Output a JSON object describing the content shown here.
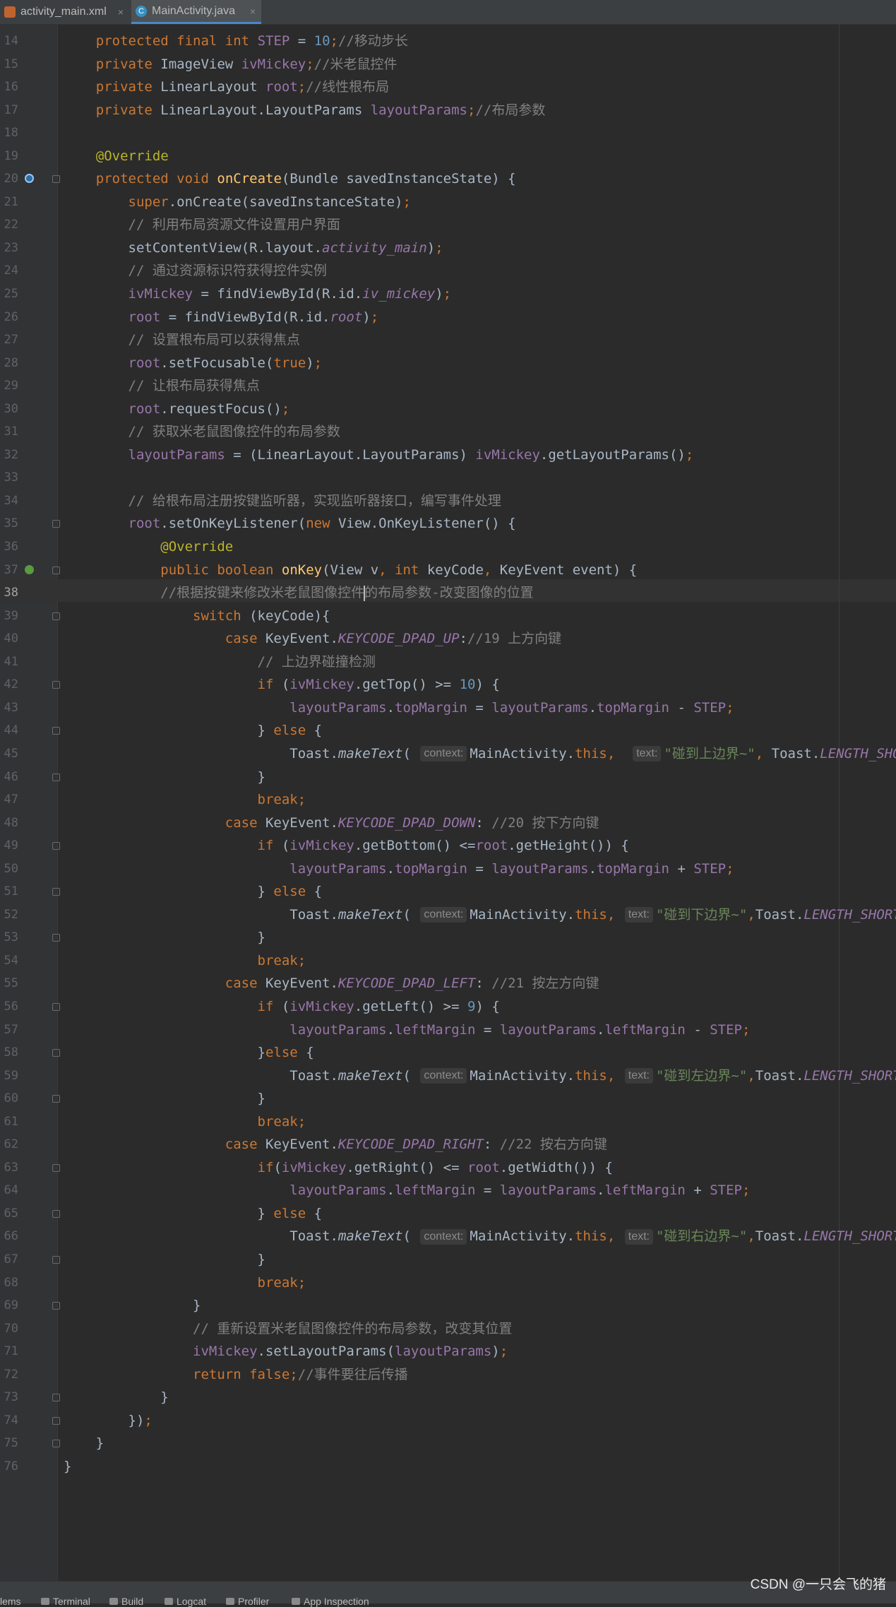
{
  "tabs": [
    {
      "label": "activity_main.xml",
      "close": "×",
      "icon": "xml-file-icon"
    },
    {
      "label": "MainActivity.java",
      "close": "×",
      "icon": "java-class-icon",
      "active": true
    }
  ],
  "editor": {
    "current_line": 38,
    "lines": [
      {
        "n": "14",
        "html": "    <span class=\"k\">protected final int</span> <span class=\"f\">STEP</span> = <span class=\"n\">10</span><span class=\"k\">;</span><span class=\"c\">//移动步长</span>"
      },
      {
        "n": "15",
        "html": "    <span class=\"k\">private</span> ImageView <span class=\"f\">ivMickey</span><span class=\"k\">;</span><span class=\"c\">//米老鼠控件</span>"
      },
      {
        "n": "16",
        "html": "    <span class=\"k\">private</span> LinearLayout <span class=\"f\">root</span><span class=\"k\">;</span><span class=\"c\">//线性根布局</span>"
      },
      {
        "n": "17",
        "html": "    <span class=\"k\">private</span> LinearLayout.LayoutParams <span class=\"f\">layoutParams</span><span class=\"k\">;</span><span class=\"c\">//布局参数</span>"
      },
      {
        "n": "18",
        "html": ""
      },
      {
        "n": "19",
        "html": "    <span class=\"a\">@Override</span>"
      },
      {
        "n": "20",
        "html": "    <span class=\"k\">protected void</span> <span class=\"m\">onCreate</span>(Bundle savedInstanceState) {",
        "marker": "override",
        "fold": true
      },
      {
        "n": "21",
        "html": "        <span class=\"k\">super</span>.onCreate(savedInstanceState)<span class=\"k\">;</span>"
      },
      {
        "n": "22",
        "html": "        <span class=\"c\">// 利用布局资源文件设置用户界面</span>"
      },
      {
        "n": "23",
        "html": "        setContentView(R.layout.<span class=\"fi2\">activity_main</span>)<span class=\"k\">;</span>"
      },
      {
        "n": "24",
        "html": "        <span class=\"c\">// 通过资源标识符获得控件实例</span>"
      },
      {
        "n": "25",
        "html": "        <span class=\"f\">ivMickey</span> = findViewById(R.id.<span class=\"fi2\">iv_mickey</span>)<span class=\"k\">;</span>"
      },
      {
        "n": "26",
        "html": "        <span class=\"f\">root</span> = findViewById(R.id.<span class=\"fi2\">root</span>)<span class=\"k\">;</span>"
      },
      {
        "n": "27",
        "html": "        <span class=\"c\">// 设置根布局可以获得焦点</span>"
      },
      {
        "n": "28",
        "html": "        <span class=\"f\">root</span>.setFocusable(<span class=\"k\">true</span>)<span class=\"k\">;</span>"
      },
      {
        "n": "29",
        "html": "        <span class=\"c\">// 让根布局获得焦点</span>"
      },
      {
        "n": "30",
        "html": "        <span class=\"f\">root</span>.requestFocus()<span class=\"k\">;</span>"
      },
      {
        "n": "31",
        "html": "        <span class=\"c\">// 获取米老鼠图像控件的布局参数</span>"
      },
      {
        "n": "32",
        "html": "        <span class=\"f\">layoutParams</span> = (LinearLayout.LayoutParams) <span class=\"f\">ivMickey</span>.getLayoutParams()<span class=\"k\">;</span>"
      },
      {
        "n": "33",
        "html": ""
      },
      {
        "n": "34",
        "html": "        <span class=\"c\">// 给根布局注册按键监听器，实现监听器接口，编写事件处理</span>"
      },
      {
        "n": "35",
        "html": "        <span class=\"f\">root</span>.setOnKeyListener(<span class=\"k\">new</span> View.OnKeyListener() {",
        "fold": true
      },
      {
        "n": "36",
        "html": "            <span class=\"a\">@Override</span>"
      },
      {
        "n": "37",
        "html": "            <span class=\"k\">public boolean</span> <span class=\"m\">onKey</span>(View v<span class=\"k\">, int</span> keyCode<span class=\"k\">,</span> KeyEvent event) {",
        "marker": "implement",
        "fold": true
      },
      {
        "n": "38",
        "html": "            <span class=\"c\">//根据按键来修改米老鼠图像控件</span><span class=\"caret\"></span><span class=\"c\">的布局参数-改变图像的位置</span>"
      },
      {
        "n": "39",
        "html": "                <span class=\"k\">switch</span> (keyCode){",
        "fold": true
      },
      {
        "n": "40",
        "html": "                    <span class=\"k\">case</span> KeyEvent.<span class=\"fi2\">KEYCODE_DPAD_UP</span>:<span class=\"c\">//19 上方向键</span>"
      },
      {
        "n": "41",
        "html": "                        <span class=\"c\">// 上边界碰撞检测</span>"
      },
      {
        "n": "42",
        "html": "                        <span class=\"k\">if</span> (<span class=\"f\">ivMickey</span>.getTop() &gt;= <span class=\"n\">10</span>) {",
        "fold": true
      },
      {
        "n": "43",
        "html": "                            <span class=\"f\">layoutParams</span>.<span class=\"f\">topMargin</span> = <span class=\"f\">layoutParams</span>.<span class=\"f\">topMargin</span> - <span class=\"f\">STEP</span><span class=\"k\">;</span>"
      },
      {
        "n": "44",
        "html": "                        } <span class=\"k\">else</span> {",
        "fold": true
      },
      {
        "n": "45",
        "html": "                            Toast.<span class=\"i\">makeText</span>( <span class=\"hint\">context:</span>MainActivity.<span class=\"k\">this,</span>  <span class=\"hint\">text:</span><span class=\"s\">\"碰到上边界~\"</span><span class=\"k\">,</span> Toast.<span class=\"fi2\">LENGTH_SHORT</span>)."
      },
      {
        "n": "46",
        "html": "                        }",
        "fold": true
      },
      {
        "n": "47",
        "html": "                        <span class=\"k\">break;</span>"
      },
      {
        "n": "48",
        "html": "                    <span class=\"k\">case</span> KeyEvent.<span class=\"fi2\">KEYCODE_DPAD_DOWN</span>: <span class=\"c\">//20 按下方向键</span>"
      },
      {
        "n": "49",
        "html": "                        <span class=\"k\">if</span> (<span class=\"f\">ivMickey</span>.getBottom() &lt;=<span class=\"f\">root</span>.getHeight()) {",
        "fold": true
      },
      {
        "n": "50",
        "html": "                            <span class=\"f\">layoutParams</span>.<span class=\"f\">topMargin</span> = <span class=\"f\">layoutParams</span>.<span class=\"f\">topMargin</span> + <span class=\"f\">STEP</span><span class=\"k\">;</span>"
      },
      {
        "n": "51",
        "html": "                        } <span class=\"k\">else</span> {",
        "fold": true
      },
      {
        "n": "52",
        "html": "                            Toast.<span class=\"i\">makeText</span>( <span class=\"hint\">context:</span>MainActivity.<span class=\"k\">this,</span> <span class=\"hint\">text:</span><span class=\"s\">\"碰到下边界~\"</span><span class=\"k\">,</span>Toast.<span class=\"fi2\">LENGTH_SHORT</span>).sh"
      },
      {
        "n": "53",
        "html": "                        }",
        "fold": true
      },
      {
        "n": "54",
        "html": "                        <span class=\"k\">break;</span>"
      },
      {
        "n": "55",
        "html": "                    <span class=\"k\">case</span> KeyEvent.<span class=\"fi2\">KEYCODE_DPAD_LEFT</span>: <span class=\"c\">//21 按左方向键</span>"
      },
      {
        "n": "56",
        "html": "                        <span class=\"k\">if</span> (<span class=\"f\">ivMickey</span>.getLeft() &gt;= <span class=\"n\">9</span>) {",
        "fold": true
      },
      {
        "n": "57",
        "html": "                            <span class=\"f\">layoutParams</span>.<span class=\"f\">leftMargin</span> = <span class=\"f\">layoutParams</span>.<span class=\"f\">leftMargin</span> - <span class=\"f\">STEP</span><span class=\"k\">;</span>"
      },
      {
        "n": "58",
        "html": "                        }<span class=\"k\">else</span> {",
        "fold": true
      },
      {
        "n": "59",
        "html": "                            Toast.<span class=\"i\">makeText</span>( <span class=\"hint\">context:</span>MainActivity.<span class=\"k\">this,</span> <span class=\"hint\">text:</span><span class=\"s\">\"碰到左边界~\"</span><span class=\"k\">,</span>Toast.<span class=\"fi2\">LENGTH_SHORT</span>).sh"
      },
      {
        "n": "60",
        "html": "                        }",
        "fold": true
      },
      {
        "n": "61",
        "html": "                        <span class=\"k\">break;</span>"
      },
      {
        "n": "62",
        "html": "                    <span class=\"k\">case</span> KeyEvent.<span class=\"fi2\">KEYCODE_DPAD_RIGHT</span>: <span class=\"c\">//22 按右方向键</span>"
      },
      {
        "n": "63",
        "html": "                        <span class=\"k\">if</span>(<span class=\"f\">ivMickey</span>.getRight() &lt;= <span class=\"f\">root</span>.getWidth()) {",
        "fold": true
      },
      {
        "n": "64",
        "html": "                            <span class=\"f\">layoutParams</span>.<span class=\"f\">leftMargin</span> = <span class=\"f\">layoutParams</span>.<span class=\"f\">leftMargin</span> + <span class=\"f\">STEP</span><span class=\"k\">;</span>"
      },
      {
        "n": "65",
        "html": "                        } <span class=\"k\">else</span> {",
        "fold": true
      },
      {
        "n": "66",
        "html": "                            Toast.<span class=\"i\">makeText</span>( <span class=\"hint\">context:</span>MainActivity.<span class=\"k\">this,</span> <span class=\"hint\">text:</span><span class=\"s\">\"碰到右边界~\"</span><span class=\"k\">,</span>Toast.<span class=\"fi2\">LENGTH_SHORT</span>).sh"
      },
      {
        "n": "67",
        "html": "                        }",
        "fold": true
      },
      {
        "n": "68",
        "html": "                        <span class=\"k\">break;</span>"
      },
      {
        "n": "69",
        "html": "                }",
        "fold": true
      },
      {
        "n": "70",
        "html": "                <span class=\"c\">// 重新设置米老鼠图像控件的布局参数，改变其位置</span>"
      },
      {
        "n": "71",
        "html": "                <span class=\"f\">ivMickey</span>.setLayoutParams(<span class=\"f\">layoutParams</span>)<span class=\"k\">;</span>"
      },
      {
        "n": "72",
        "html": "                <span class=\"k\">return false;</span><span class=\"c\">//事件要往后传播</span>"
      },
      {
        "n": "73",
        "html": "            }",
        "fold": true
      },
      {
        "n": "74",
        "html": "        })<span class=\"k\">;</span>",
        "fold": true
      },
      {
        "n": "75",
        "html": "    }",
        "fold": true
      },
      {
        "n": "76",
        "html": "}"
      }
    ]
  },
  "statusbar": {
    "items": [
      {
        "label": "lems",
        "icon": "problems-icon"
      },
      {
        "label": "Terminal",
        "icon": "terminal-icon"
      },
      {
        "label": "Build",
        "icon": "build-icon"
      },
      {
        "label": "Logcat",
        "icon": "logcat-icon"
      },
      {
        "label": "Profiler",
        "icon": "profiler-icon"
      },
      {
        "label": "App Inspection",
        "icon": "app-inspection-icon"
      }
    ]
  },
  "watermark": "CSDN @一只会飞的猪"
}
